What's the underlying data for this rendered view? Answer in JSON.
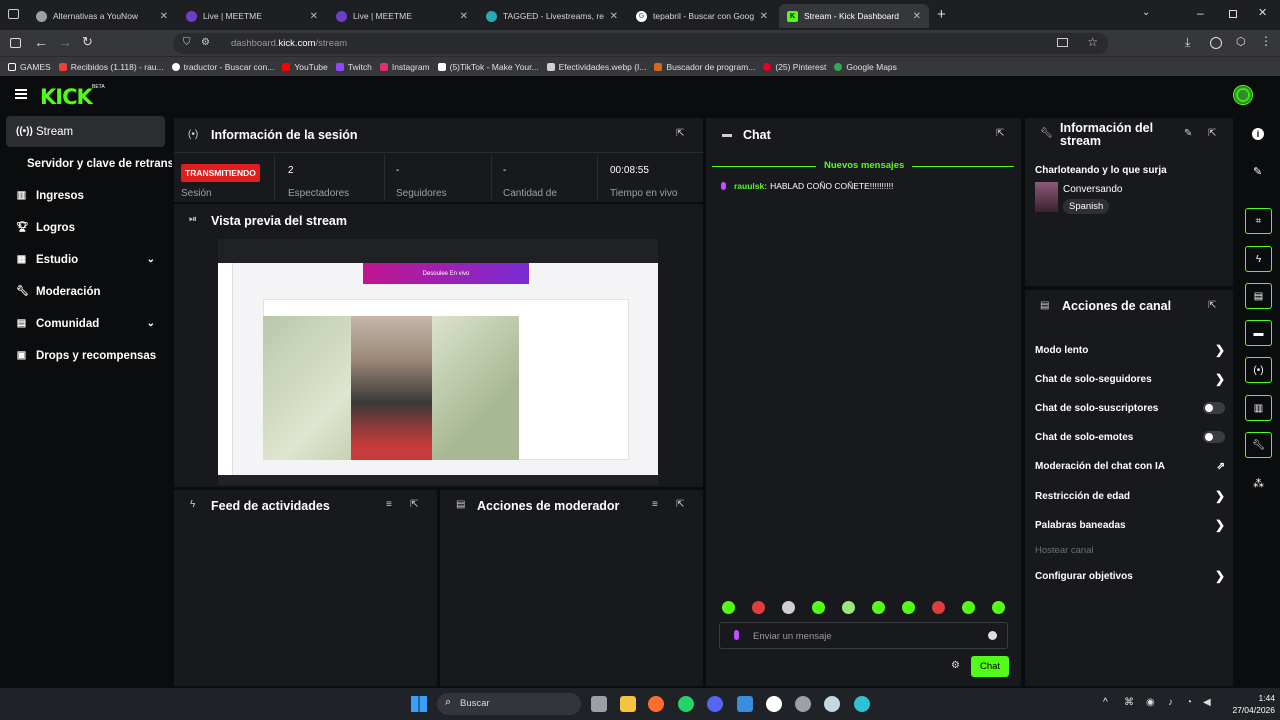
{
  "browser": {
    "tabs": [
      {
        "label": "Alternativas a YouNow",
        "color": "#9aa0a6"
      },
      {
        "label": "Live | MEETME",
        "color": "#6d3fc8"
      },
      {
        "label": "Live | MEETME",
        "color": "#6d3fc8"
      },
      {
        "label": "TAGGED - Livestreams, real pe...",
        "color": "#28a9b6"
      },
      {
        "label": "tepabril - Buscar con Google",
        "color": "#ffffff"
      },
      {
        "label": "Stream - Kick Dashboard",
        "color": "#53fc18"
      }
    ],
    "url_host": "dashboard.",
    "url_domain": "kick.com",
    "url_path": "/stream",
    "bookmarks": [
      {
        "label": "GAMES",
        "color": "#ffffff"
      },
      {
        "label": "Recibidos (1.118) - rau...",
        "color": "#ea4335"
      },
      {
        "label": "traductor - Buscar con...",
        "color": "#ffffff"
      },
      {
        "label": "YouTube",
        "color": "#ff0000"
      },
      {
        "label": "Twitch",
        "color": "#9146ff"
      },
      {
        "label": "Instagram",
        "color": "#e1306c"
      },
      {
        "label": "(5)TikTok - Make Your...",
        "color": "#ffffff"
      },
      {
        "label": "Efectividades.webp (I...",
        "color": "#d0d0d0"
      },
      {
        "label": "Buscador de program...",
        "color": "#d2691e"
      },
      {
        "label": "(25) Pinterest",
        "color": "#e60023"
      },
      {
        "label": "Google Maps",
        "color": "#34a853"
      }
    ]
  },
  "kick": {
    "logo": "KICK",
    "beta": "BETA",
    "accent": "#53fc18"
  },
  "sidebar": {
    "items": [
      {
        "label": "Stream",
        "icon": "broadcast-icon"
      },
      {
        "label": "Servidor y clave de retransm",
        "icon": ""
      },
      {
        "label": "Ingresos",
        "icon": "chart-icon"
      },
      {
        "label": "Logros",
        "icon": "trophy-icon"
      },
      {
        "label": "Estudio",
        "icon": "grid-icon"
      },
      {
        "label": "Moderación",
        "icon": "wrench-icon"
      },
      {
        "label": "Comunidad",
        "icon": "users-icon"
      },
      {
        "label": "Drops y recompensas",
        "icon": "drops-icon"
      }
    ]
  },
  "session": {
    "title": "Información de la sesión",
    "status_badge": "TRANSMITIENDO",
    "status_label": "Sesión",
    "stats": [
      {
        "value": "2",
        "label": "Espectadores"
      },
      {
        "value": "-",
        "label": "Seguidores"
      },
      {
        "value": "-",
        "label": "Cantidad de"
      },
      {
        "value": "00:08:55",
        "label": "Tiempo en vivo"
      }
    ]
  },
  "preview": {
    "title": "Vista previa del stream",
    "banner": "Desoulee En vivo"
  },
  "feed": {
    "title": "Feed de actividades"
  },
  "modactions": {
    "title": "Acciones de moderador"
  },
  "chat": {
    "title": "Chat",
    "new_messages": "Nuevos mensajes",
    "messages": [
      {
        "user": "rauulsk:",
        "text": "HABLAD COÑO COÑETE!!!!!!!!!!"
      }
    ],
    "input_placeholder": "Enviar un mensaje",
    "send_label": "Chat"
  },
  "stream_info": {
    "title": "Información del stream",
    "stream_title": "Charloteando y lo que surja",
    "category": "Conversando",
    "language": "Spanish"
  },
  "channel_actions": {
    "title": "Acciones de canal",
    "items": [
      {
        "label": "Modo lento",
        "control": "arrow"
      },
      {
        "label": "Chat de solo-seguidores",
        "control": "arrow"
      },
      {
        "label": "Chat de solo-suscriptores",
        "control": "toggle"
      },
      {
        "label": "Chat de solo-emotes",
        "control": "toggle"
      },
      {
        "label": "Moderación del chat con IA",
        "control": "external"
      },
      {
        "label": "Restricción de edad",
        "control": "arrow"
      },
      {
        "label": "Palabras baneadas",
        "control": "arrow"
      },
      {
        "label": "Hostear canal",
        "control": "none"
      },
      {
        "label": "Configurar objetivos",
        "control": "arrow"
      }
    ]
  },
  "taskbar": {
    "search_placeholder": "Buscar",
    "time": "1:44",
    "date": "27/04/2026"
  }
}
